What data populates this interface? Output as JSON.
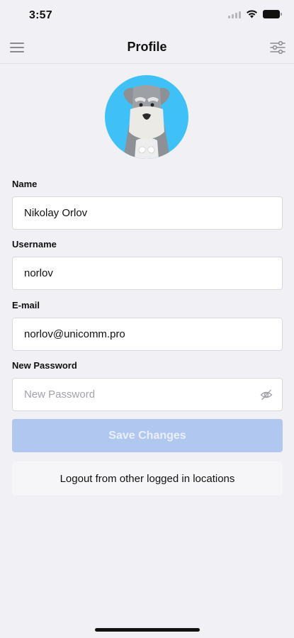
{
  "status_bar": {
    "time": "3:57"
  },
  "header": {
    "title": "Profile",
    "menu_icon": "hamburger-menu-icon",
    "settings_icon": "sliders-icon"
  },
  "avatar": {
    "icon": "schnauzer-dog-avatar",
    "background": "#3fc1f7"
  },
  "form": {
    "name": {
      "label": "Name",
      "value": "Nikolay Orlov"
    },
    "username": {
      "label": "Username",
      "value": "norlov"
    },
    "email": {
      "label": "E-mail",
      "value": "norlov@unicomm.pro"
    },
    "password": {
      "label": "New Password",
      "placeholder": "New Password",
      "value": ""
    }
  },
  "actions": {
    "save_label": "Save Changes",
    "logout_label": "Logout from other logged in locations"
  },
  "colors": {
    "background": "#f0f0f5",
    "save_disabled": "#b0c8f0"
  }
}
